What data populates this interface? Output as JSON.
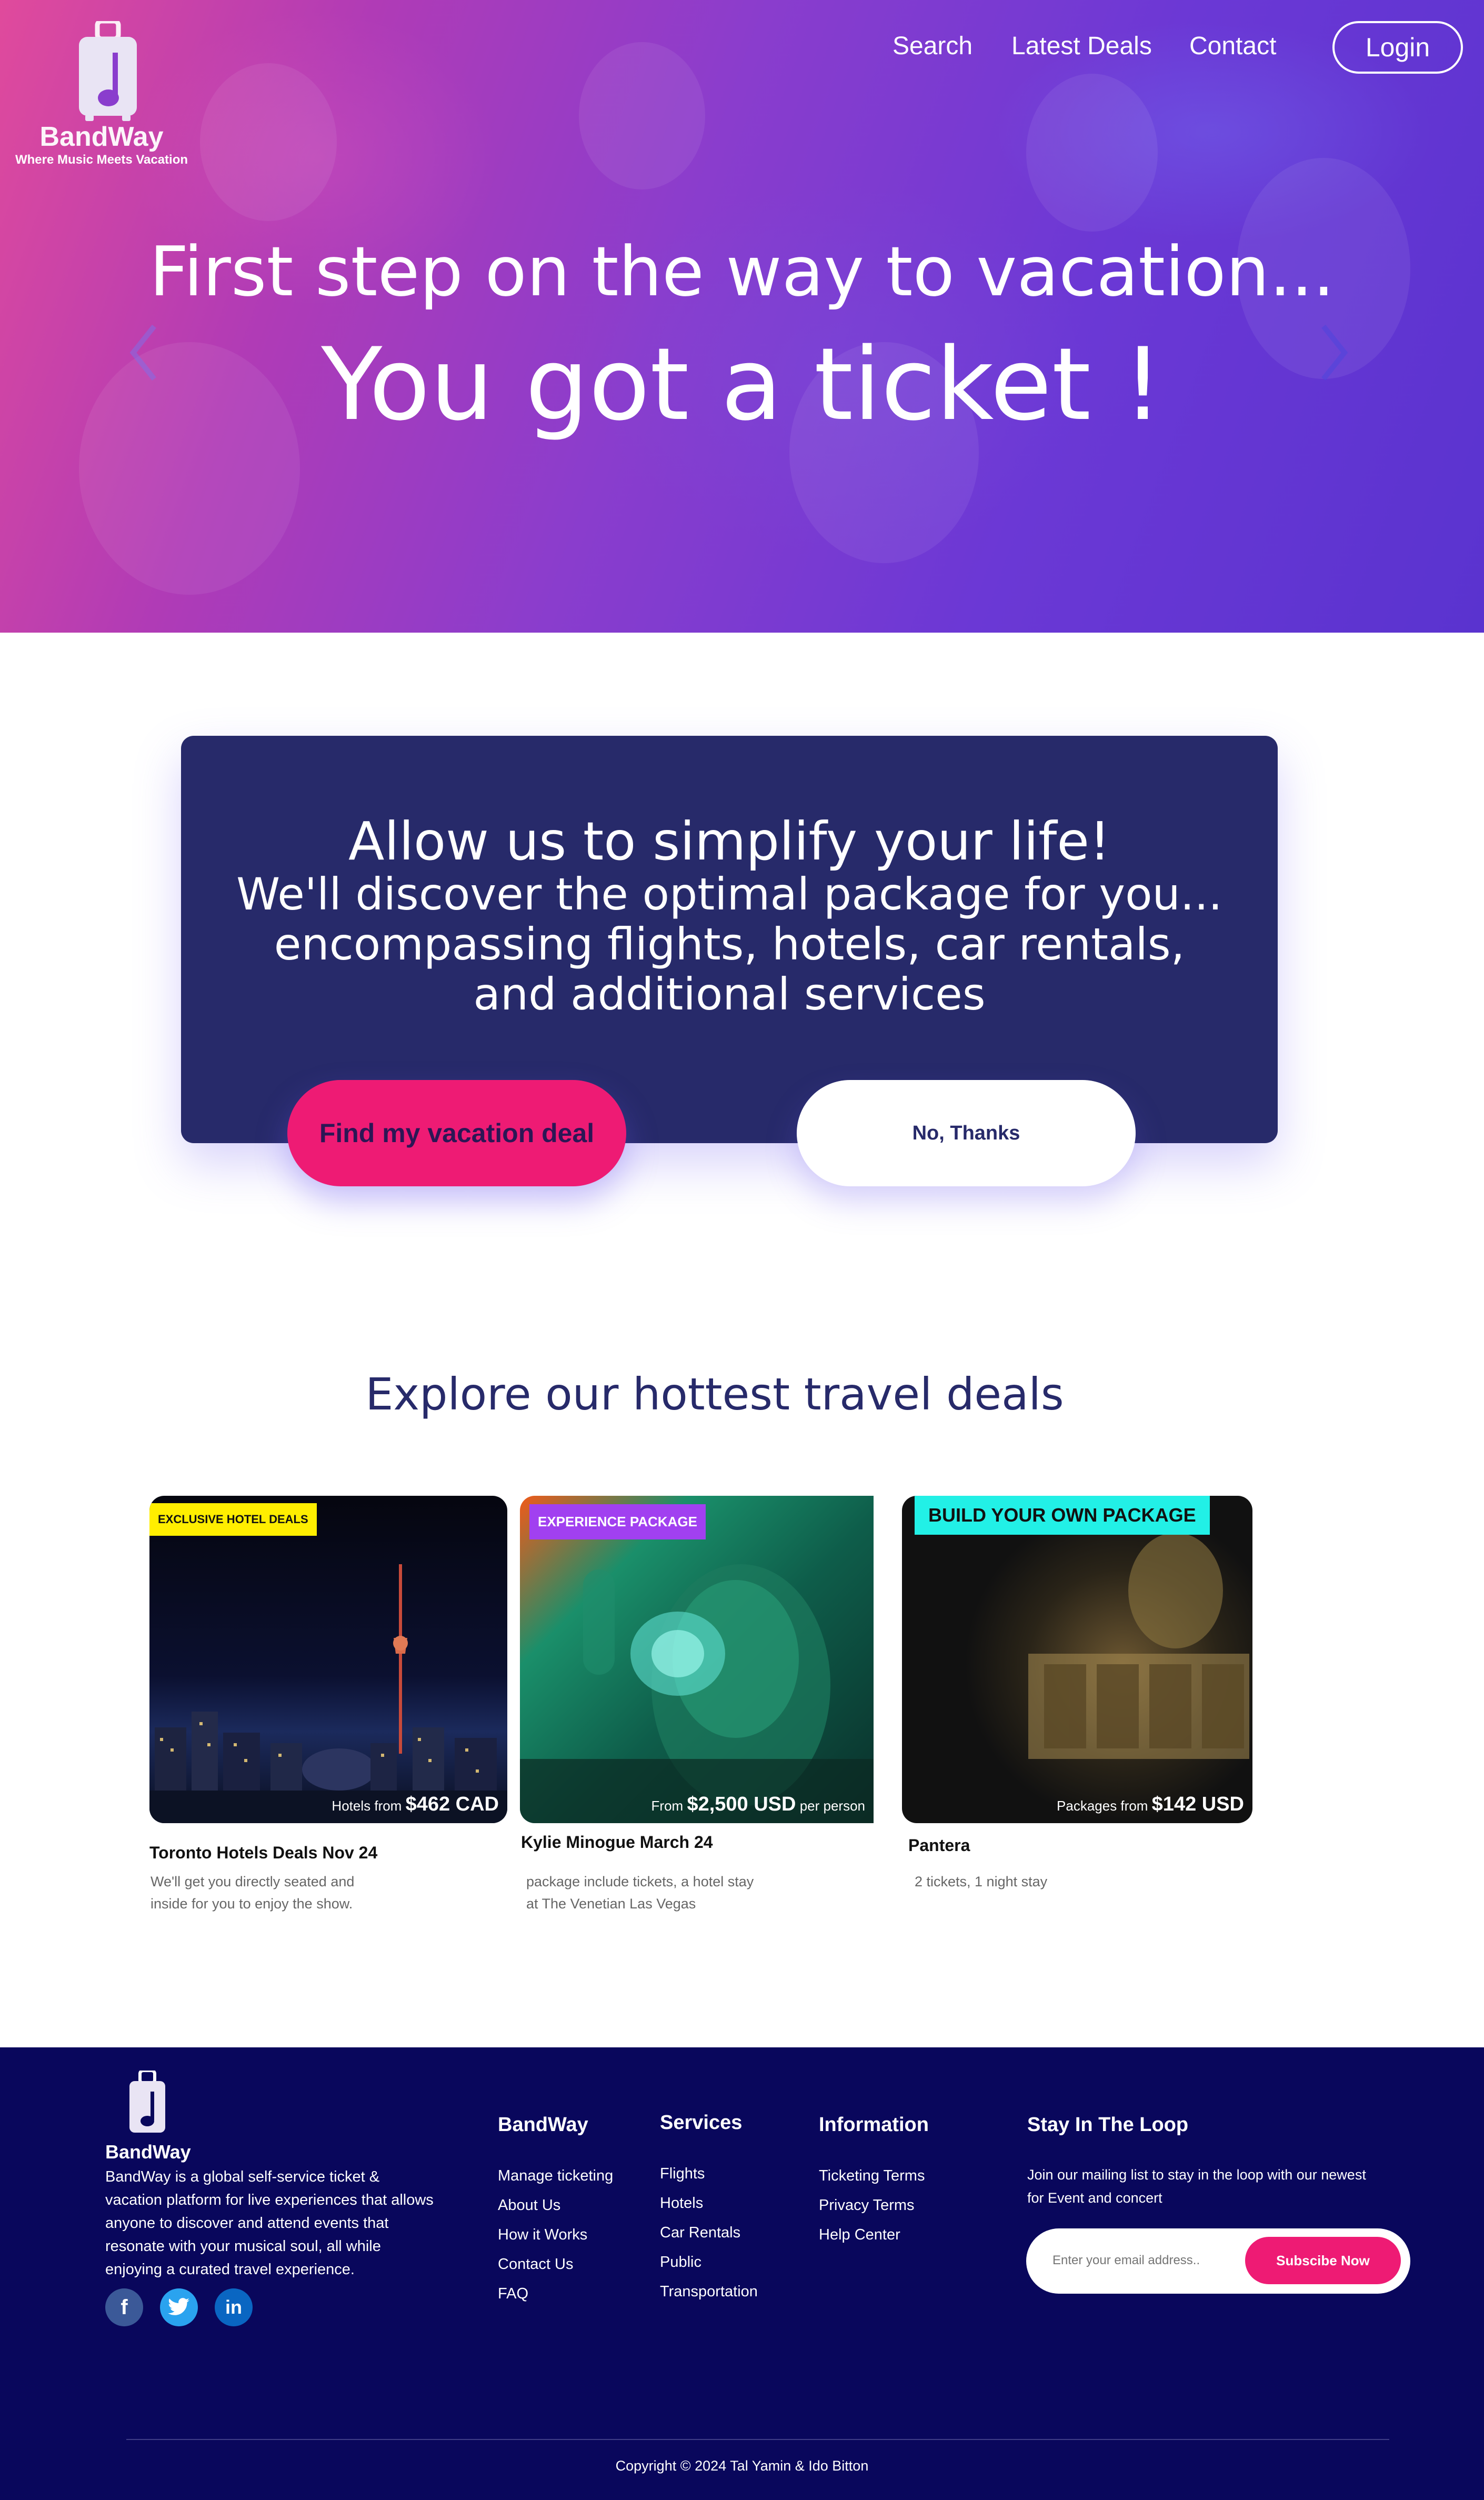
{
  "colors": {
    "primary_pink": "#ee1b74",
    "navy": "#272a6a",
    "footer_bg": "#09075c",
    "hero_gradient_start": "#e04a9c",
    "hero_gradient_end": "#5a33cf",
    "badge_yellow": "#ffee00",
    "badge_purple": "#a140f0",
    "badge_cyan": "#22f0e6"
  },
  "header": {
    "logo_name": "BandWay",
    "logo_tagline": "Where Music Meets Vacation",
    "logo_icon": "luggage-music-note-icon",
    "nav": [
      {
        "label": "Search"
      },
      {
        "label": "Latest Deals"
      },
      {
        "label": "Contact"
      }
    ],
    "login_label": "Login"
  },
  "hero": {
    "line1": "First step on the way to vacation...",
    "line2": "You got a ticket !",
    "prev_icon": "chevron-left-icon",
    "next_icon": "chevron-right-icon"
  },
  "promo": {
    "line1": "Allow us to simplify your life!",
    "line2": "We'll discover the optimal package for you...",
    "line3": "encompassing flights, hotels, car rentals,",
    "line4": "and additional services",
    "find_button": "Find my vacation deal",
    "no_button": "No, Thanks"
  },
  "deals": {
    "title": "Explore our hottest travel deals",
    "cards": [
      {
        "badge": "EXCLUSIVE HOTEL DEALS",
        "price_prefix": "Hotels from",
        "price": "$462 CAD",
        "price_suffix": "",
        "title": "Toronto Hotels Deals Nov 24",
        "desc_line1": "We'll get you directly seated and",
        "desc_line2": "inside for you to enjoy the show."
      },
      {
        "badge": "EXPERIENCE PACKAGE",
        "price_prefix": "From",
        "price": "$2,500 USD",
        "price_suffix": "per person",
        "title": "Kylie Minogue March 24",
        "desc_line1": "package include tickets, a hotel stay",
        "desc_line2": "at The Venetian Las Vegas"
      },
      {
        "badge": "BUILD YOUR OWN PACKAGE",
        "price_prefix": "Packages from",
        "price": "$142 USD",
        "price_suffix": "",
        "title": "Pantera",
        "desc_line1": "2 tickets, 1 night stay",
        "desc_line2": ""
      }
    ]
  },
  "footer": {
    "brand": "BandWay",
    "about_lines": [
      "BandWay is a global self-service ticket &",
      "vacation platform for live experiences that allows",
      "anyone to discover and attend events that",
      "resonate with your musical soul, all while",
      "enjoying a curated travel experience."
    ],
    "social": [
      {
        "icon": "facebook-icon",
        "glyph": "f",
        "color": "#3b5998"
      },
      {
        "icon": "twitter-icon",
        "glyph": "",
        "color": "#2aa3ef"
      },
      {
        "icon": "linkedin-icon",
        "glyph": "in",
        "color": "#0a66c2"
      }
    ],
    "col_bandway": {
      "heading": "BandWay",
      "links": [
        "Manage ticketing",
        "About Us",
        "How it Works",
        "Contact Us",
        "FAQ"
      ]
    },
    "col_services": {
      "heading": "Services",
      "links": [
        "Flights",
        "Hotels",
        "Car Rentals",
        "Public",
        "Transportation"
      ]
    },
    "col_information": {
      "heading": "Information",
      "links": [
        "Ticketing Terms",
        "Privacy Terms",
        "Help Center"
      ]
    },
    "newsletter": {
      "heading": "Stay In The Loop",
      "text_line1": "Join our mailing list to stay in the loop with our newest",
      "text_line2": "for Event and concert",
      "placeholder": "Enter your email address..",
      "button": "Subscibe Now"
    },
    "copyright": "Copyright © 2024 Tal Yamin & Ido Bitton"
  }
}
